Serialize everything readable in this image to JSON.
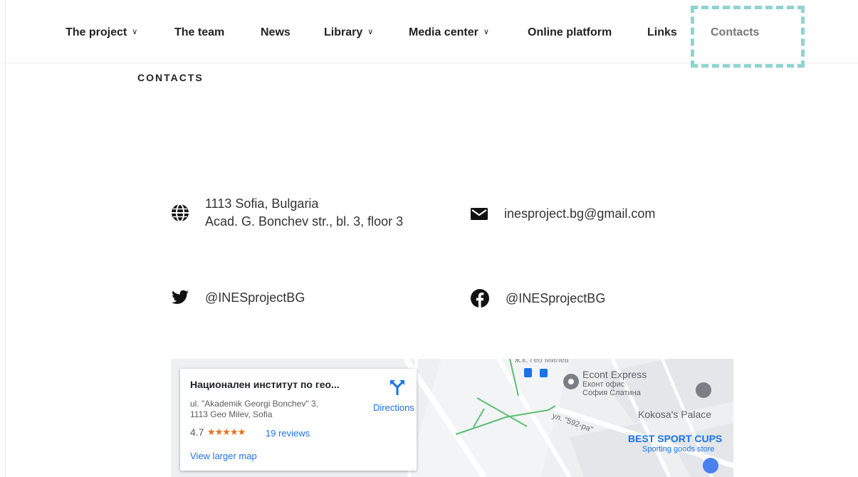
{
  "nav": {
    "items": [
      {
        "label": "The project",
        "dropdown": true
      },
      {
        "label": "The team",
        "dropdown": false
      },
      {
        "label": "News",
        "dropdown": false
      },
      {
        "label": "Library",
        "dropdown": true
      },
      {
        "label": "Media center",
        "dropdown": true
      },
      {
        "label": "Online platform",
        "dropdown": false
      },
      {
        "label": "Links",
        "dropdown": false
      },
      {
        "label": "Contacts",
        "dropdown": false,
        "current": true
      }
    ],
    "caret": "∨"
  },
  "page": {
    "title": "CONTACTS"
  },
  "contacts": {
    "address_line1": "1113 Sofia, Bulgaria",
    "address_line2": "Acad. G. Bonchev str., bl. 3, floor 3",
    "email": "inesproject.bg@gmail.com",
    "twitter": "@INESprojectBG",
    "facebook": "@INESprojectBG"
  },
  "map": {
    "card": {
      "title": "Национален институт по гео...",
      "address_line1": "ul. \"Akademik Georgi Bonchev\" 3,",
      "address_line2": "1113 Geo Milev, Sofia",
      "rating": "4.7",
      "stars": "★★★★★",
      "reviews": "19 reviews",
      "directions": "Directions",
      "larger_map": "View larger map"
    },
    "labels": {
      "district": "ж.к. Гео Милев",
      "econt_en": "Econt Express",
      "econt_bg1": "Еконт офис",
      "econt_bg2": "София Слатина",
      "kokosa": "Kokosa's Palace",
      "sport": "BEST SPORT CUPS",
      "sport_sub": "Sporting goods store",
      "street": "ул. \"592-ра\""
    }
  },
  "colors": {
    "accent_focus": "#8fd3d2",
    "link_blue": "#1a73e8",
    "star_orange": "#e7711b",
    "map_green": "#5cbf72"
  }
}
